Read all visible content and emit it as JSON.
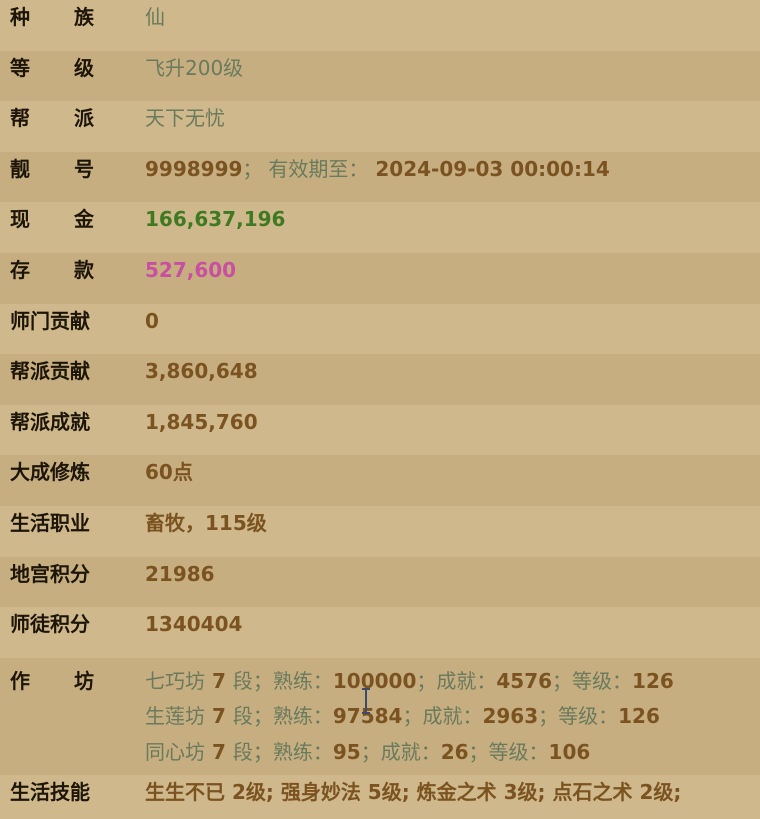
{
  "rows": {
    "race": {
      "l1": "种",
      "l2": "族",
      "value": "仙"
    },
    "level": {
      "l1": "等",
      "l2": "级",
      "value": "飞升200级"
    },
    "gang": {
      "l1": "帮",
      "l2": "派",
      "value": "天下无忧"
    },
    "pretty_id": {
      "l1": "靓",
      "l2": "号",
      "number": "9998999",
      "semi": "；",
      "valid_label": "有效期至：",
      "valid_value": "2024-09-03 00:00:14"
    },
    "cash": {
      "l1": "现",
      "l2": "金",
      "value": "166,637,196"
    },
    "deposit": {
      "l1": "存",
      "l2": "款",
      "value": "527,600"
    },
    "sect_contrib": {
      "label": "师门贡献",
      "value": "0"
    },
    "gang_contrib": {
      "label": "帮派贡献",
      "value": "3,860,648"
    },
    "gang_achieve": {
      "label": "帮派成就",
      "value": "1,845,760"
    },
    "cultivation": {
      "label": "大成修炼",
      "value": "60点"
    },
    "life_job": {
      "label": "生活职业",
      "value": "畜牧，115级"
    },
    "dungeon_points": {
      "label": "地宫积分",
      "value": "21986"
    },
    "mentor_points": {
      "label": "师徒积分",
      "value": "1340404"
    },
    "workshop": {
      "l1": "作",
      "l2": "坊",
      "lines": [
        {
          "name": "七巧坊",
          "seg": "7",
          "seg_unit": "段；熟练：",
          "prof": "100000",
          "ach_label": "；成就：",
          "ach": "4576",
          "lvl_label": "；等级：",
          "lvl": "126"
        },
        {
          "name": "生莲坊",
          "seg": "7",
          "seg_unit": "段；熟练：",
          "prof": "97584",
          "ach_label": "；成就：",
          "ach": "2963",
          "lvl_label": "；等级：",
          "lvl": "126"
        },
        {
          "name": "同心坊",
          "seg": "7",
          "seg_unit": "段；熟练：",
          "prof": "95",
          "ach_label": "；成就：",
          "ach": "26",
          "lvl_label": "；等级：",
          "lvl": "106"
        }
      ]
    },
    "life_skills": {
      "label": "生活技能",
      "value": "生生不已 2级; 强身妙法 5级; 炼金之术 3级; 点石之术 2级;"
    }
  },
  "colors": {
    "background": "#d3bc8e",
    "label": "#1d1506",
    "value": "#7b5320",
    "muted": "#6a7a5d",
    "cash": "#3f7a22",
    "deposit": "#c94fa0"
  },
  "icons": {
    "mouse_cursor": "text-cursor-icon"
  }
}
